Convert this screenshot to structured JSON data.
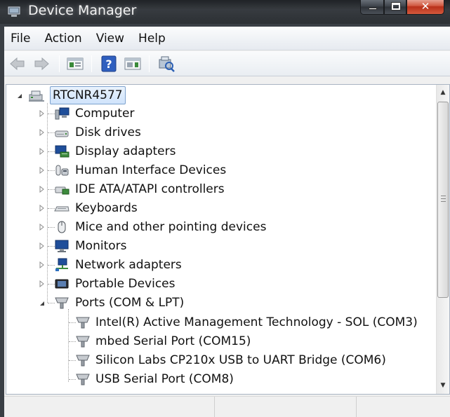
{
  "window": {
    "title": "Device Manager"
  },
  "menu": {
    "items": [
      {
        "label": "File"
      },
      {
        "label": "Action"
      },
      {
        "label": "View"
      },
      {
        "label": "Help"
      }
    ]
  },
  "toolbar": {
    "buttons": [
      "back-arrow-icon",
      "forward-arrow-icon",
      "properties-icon",
      "help-icon",
      "view-icon",
      "scan-hardware-icon"
    ]
  },
  "tree": {
    "root": {
      "label": "RTCNR4577",
      "expanded": true,
      "selected": true
    },
    "categories": [
      {
        "label": "Computer",
        "icon": "computer-icon",
        "expanded": false
      },
      {
        "label": "Disk drives",
        "icon": "disk-drive-icon",
        "expanded": false
      },
      {
        "label": "Display adapters",
        "icon": "display-adapter-icon",
        "expanded": false
      },
      {
        "label": "Human Interface Devices",
        "icon": "hid-icon",
        "expanded": false
      },
      {
        "label": "IDE ATA/ATAPI controllers",
        "icon": "ide-controller-icon",
        "expanded": false
      },
      {
        "label": "Keyboards",
        "icon": "keyboard-icon",
        "expanded": false
      },
      {
        "label": "Mice and other pointing devices",
        "icon": "mouse-icon",
        "expanded": false
      },
      {
        "label": "Monitors",
        "icon": "monitor-icon",
        "expanded": false
      },
      {
        "label": "Network adapters",
        "icon": "network-adapter-icon",
        "expanded": false
      },
      {
        "label": "Portable Devices",
        "icon": "portable-device-icon",
        "expanded": false
      },
      {
        "label": "Ports (COM & LPT)",
        "icon": "port-icon",
        "expanded": true
      }
    ],
    "ports": [
      {
        "label": "Intel(R) Active Management Technology - SOL (COM3)"
      },
      {
        "label": "mbed Serial Port (COM15)"
      },
      {
        "label": "Silicon Labs CP210x USB to UART Bridge (COM6)"
      },
      {
        "label": "USB Serial Port (COM8)"
      }
    ]
  },
  "colors": {
    "selection_border": "#7da2ce",
    "tree_background": "#ffffff",
    "titlebar": "#2c3034"
  }
}
